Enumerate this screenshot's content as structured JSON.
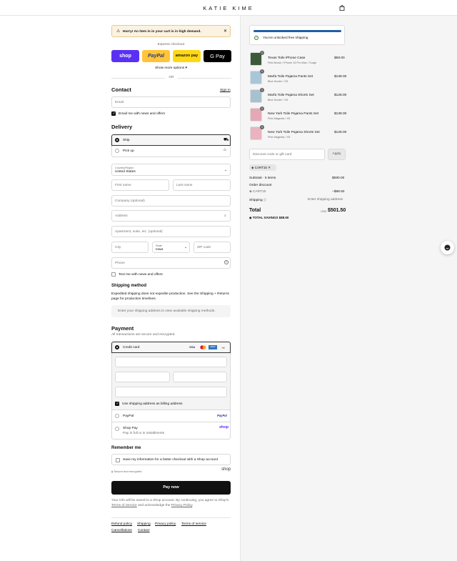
{
  "header": {
    "brand": "KATIE KIME",
    "cart_icon": "bag-icon"
  },
  "alert": {
    "text": "Hurry! An item in in your cart is in high demand.",
    "icon": "warning-icon"
  },
  "express": {
    "label": "Express checkout",
    "buttons": [
      {
        "label": "shop",
        "color": "#5a31f4"
      },
      {
        "label": "PayPal",
        "color": "#ffc439"
      },
      {
        "label": "amazon pay",
        "color": "#ffd814"
      },
      {
        "label": "G Pay",
        "color": "#000000"
      }
    ],
    "more": "Show more options",
    "or": "OR"
  },
  "contact": {
    "title": "Contact",
    "signin": "Sign in",
    "email_placeholder": "Email",
    "news_label": "Email me with news and offers"
  },
  "delivery": {
    "title": "Delivery",
    "ship": "Ship",
    "pickup": "Pick up",
    "country_label": "Country/Region",
    "country_value": "United States",
    "first_name": "First name",
    "last_name": "Last name",
    "company": "Company (optional)",
    "address": "Address",
    "apartment": "Apartment, suite, etc. (optional)",
    "city": "City",
    "state_label": "State",
    "state_value": "Iowa",
    "zip": "ZIP code",
    "phone": "Phone",
    "text_news": "Text me with news and offers"
  },
  "shipping_method": {
    "title": "Shipping method",
    "note": "Expedited shipping does not expedite production. See the Shipping + Returns page for production timelines.",
    "placeholder": "Enter your shipping address to view available shipping methods."
  },
  "payment": {
    "title": "Payment",
    "subtitle": "All transactions are secure and encrypted.",
    "credit_card": "Credit card",
    "cards": [
      "VISA",
      "MC",
      "AMEX",
      "+4"
    ],
    "billing_same": "Use shipping address as billing address",
    "paypal": "PayPal",
    "shop_pay": "Shop Pay",
    "shop_pay_sub": "Pay in full or in installments",
    "shop_logo": "shop"
  },
  "remember": {
    "title": "Remember me",
    "save_label": "Save my information for a faster checkout with a Shop account",
    "secure": "Secure and encrypted",
    "shop_logo": "shop"
  },
  "pay_now": "Pay now",
  "legal": {
    "prefix": "Your info will be saved to a Shop account. By continuing, you agree to Shop's",
    "terms": "Terms of Service",
    "middle": "and acknowledge the",
    "privacy": "Privacy Policy",
    "suffix": "."
  },
  "footer_links": [
    "Refund policy",
    "Shipping",
    "Privacy policy",
    "Terms of service",
    "Cancellations",
    "Contact"
  ],
  "summary": {
    "free_shipping": "You've unlocked free shipping",
    "free_shipping_progress": 1.0,
    "items": [
      {
        "qty": "1",
        "name": "Texas Toile iPhone Case",
        "variant": "Pink Brown / iPhone 15 Pro Max / Tough",
        "price": "$58.00",
        "color": "#3c5a3a"
      },
      {
        "qty": "1",
        "name": "Marfa Toile Pajama Pants Set",
        "variant": "Blue Hunter / XS",
        "price": "$138.00",
        "color": "#a9c6d8"
      },
      {
        "qty": "1",
        "name": "Marfa Toile Pajama Shorts Set",
        "variant": "Blue Hunter / XS",
        "price": "$128.00",
        "color": "#a7c2cf"
      },
      {
        "qty": "1",
        "name": "New York Toile Pajama Pants Set",
        "variant": "Pink Magenta / XS",
        "price": "$138.00",
        "color": "#e6a7b6"
      },
      {
        "qty": "1",
        "name": "New York Toile Pajama Shorts Set",
        "variant": "Pink Magenta / XS",
        "price": "$128.00",
        "color": "#e9b3bf"
      }
    ],
    "discount_placeholder": "Discount code or gift card",
    "apply": "Apply",
    "code_chip": "CART15",
    "subtotal_label": "Subtotal · 5 items",
    "subtotal_value": "$590.00",
    "order_discount": "Order discount",
    "discount_code": "CART15",
    "discount_value": "−$88.50",
    "shipping_label": "Shipping",
    "shipping_value": "Enter shipping address",
    "total_label": "Total",
    "currency": "USD",
    "total_value": "$501.50",
    "savings_label": "TOTAL SAVINGS",
    "savings_value": "$88.50"
  }
}
